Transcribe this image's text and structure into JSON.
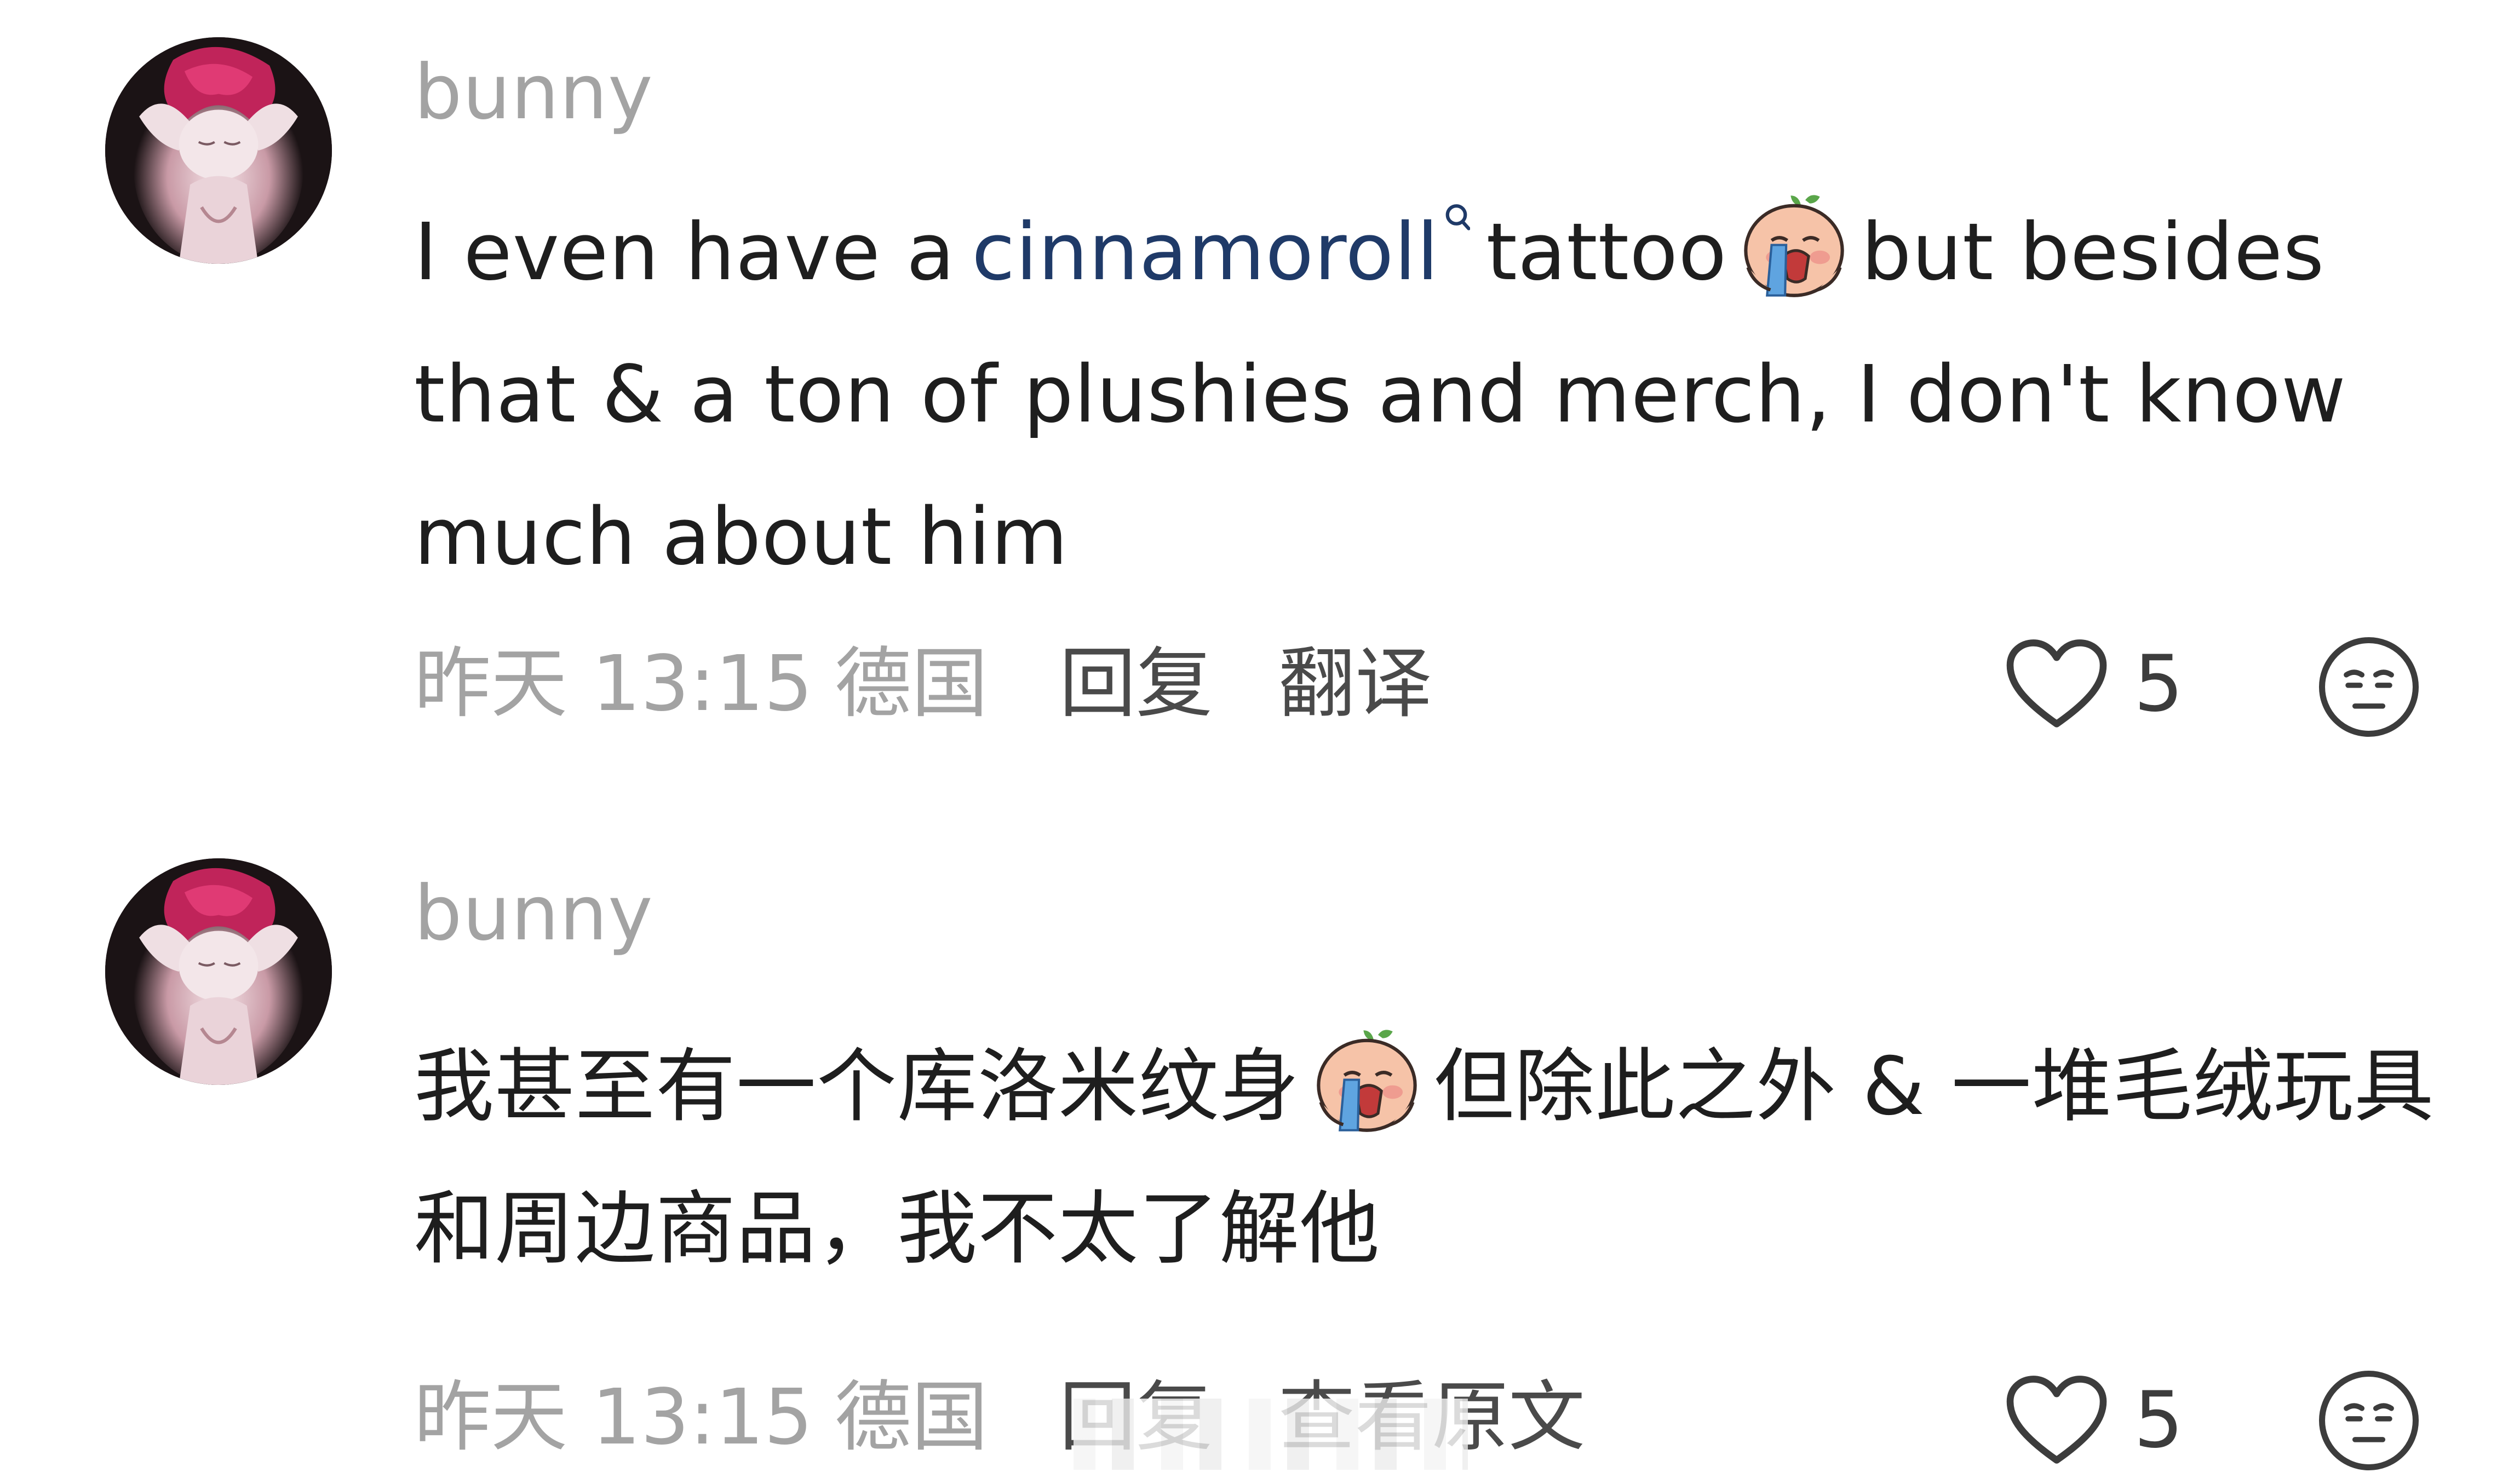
{
  "comments": [
    {
      "username": "bunny",
      "text_before_link": "I even have a",
      "link_text": "cinnamoroll",
      "text_after_link": "tattoo",
      "text_after_emoji": "but besides that & a ton of plushies and merch, I don't know much about him",
      "emoji": "crying-face-emoji",
      "time": "昨天 13:15",
      "location": "德国",
      "reply_label": "回复",
      "secondary_action_label": "翻译",
      "like_count": "5"
    },
    {
      "username": "bunny",
      "text_before_emoji": "我甚至有一个库洛米纹身",
      "text_after_emoji": "但除此之外 & 一堆毛绒玩具和周边商品，我不太了解他",
      "emoji": "crying-face-emoji",
      "time": "昨天 13:15",
      "location": "德国",
      "reply_label": "回复",
      "secondary_action_label": "查看原文",
      "like_count": "5"
    }
  ],
  "colors": {
    "username": "#a3a3a3",
    "body_text": "#1e1e1e",
    "link": "#1f3a68",
    "meta": "#a3a3a3",
    "action": "#4a4a4a"
  },
  "icons": {
    "like": "heart-outline-icon",
    "reaction": "neutral-face-icon",
    "link_search": "search-icon"
  }
}
